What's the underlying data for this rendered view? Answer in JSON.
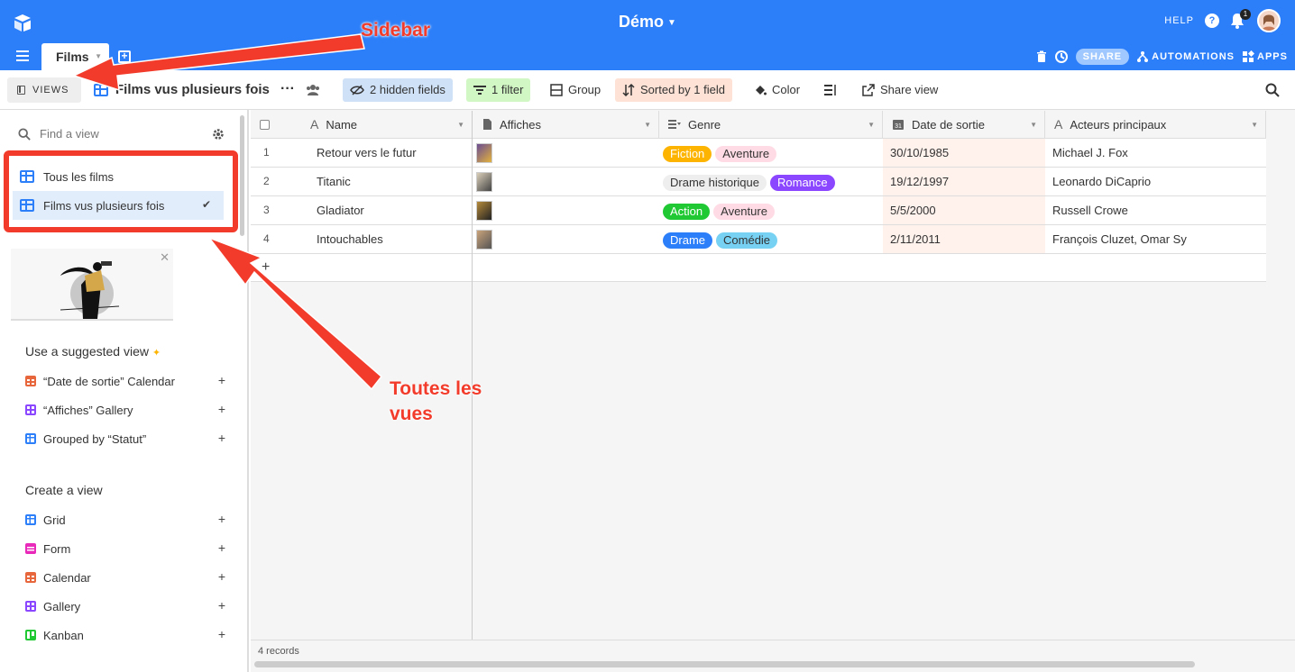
{
  "app": {
    "base_title": "Démo",
    "help_label": "HELP",
    "notification_count": "1"
  },
  "tabs": {
    "active": "Films"
  },
  "header_actions": {
    "share": "SHARE",
    "automations": "AUTOMATIONS",
    "apps": "APPS"
  },
  "toolbar": {
    "views_label": "VIEWS",
    "view_title": "Films vus plusieurs fois",
    "hidden_fields": "2 hidden fields",
    "filter": "1 filter",
    "group": "Group",
    "sort": "Sorted by 1 field",
    "color": "Color",
    "share_view": "Share view"
  },
  "sidebar": {
    "find_placeholder": "Find a view",
    "views": [
      {
        "label": "Tous les films",
        "selected": false
      },
      {
        "label": "Films vus plusieurs fois",
        "selected": true
      }
    ],
    "suggested_title": "Use a suggested view",
    "suggested": [
      {
        "label": "“Date de sortie” Calendar",
        "icon": "calendar-icon",
        "color": "#e8663c"
      },
      {
        "label": "“Affiches” Gallery",
        "icon": "gallery-icon",
        "color": "#8b46ff"
      },
      {
        "label": "Grouped by “Statut”",
        "icon": "grid-icon",
        "color": "#2d7ff9"
      }
    ],
    "create_title": "Create a view",
    "create": [
      {
        "label": "Grid",
        "icon": "grid-icon",
        "color": "#2d7ff9"
      },
      {
        "label": "Form",
        "icon": "form-icon",
        "color": "#e929ba"
      },
      {
        "label": "Calendar",
        "icon": "calendar-icon",
        "color": "#e8663c"
      },
      {
        "label": "Gallery",
        "icon": "gallery-icon",
        "color": "#8b46ff"
      },
      {
        "label": "Kanban",
        "icon": "kanban-icon",
        "color": "#20c933"
      }
    ]
  },
  "grid": {
    "columns": [
      "Name",
      "Affiches",
      "Genre",
      "Date de sortie",
      "Acteurs principaux"
    ],
    "rows": [
      {
        "num": "1",
        "name": "Retour vers le futur",
        "genres": [
          {
            "t": "Fiction",
            "bg": "#fcb400",
            "fg": "#fff"
          },
          {
            "t": "Aventure",
            "bg": "#ffdce5",
            "fg": "#333"
          }
        ],
        "date": "30/10/1985",
        "actors": "Michael J. Fox"
      },
      {
        "num": "2",
        "name": "Titanic",
        "genres": [
          {
            "t": "Drame historique",
            "bg": "#eeeeee",
            "fg": "#333"
          },
          {
            "t": "Romance",
            "bg": "#8b46ff",
            "fg": "#fff"
          }
        ],
        "date": "19/12/1997",
        "actors": "Leonardo DiCaprio"
      },
      {
        "num": "3",
        "name": "Gladiator",
        "genres": [
          {
            "t": "Action",
            "bg": "#20c933",
            "fg": "#fff"
          },
          {
            "t": "Aventure",
            "bg": "#ffdce5",
            "fg": "#333"
          }
        ],
        "date": "5/5/2000",
        "actors": "Russell Crowe"
      },
      {
        "num": "4",
        "name": "Intouchables",
        "genres": [
          {
            "t": "Drame",
            "bg": "#2d7ff9",
            "fg": "#fff"
          },
          {
            "t": "Comédie",
            "bg": "#77d1f3",
            "fg": "#333"
          }
        ],
        "date": "2/11/2011",
        "actors": "François Cluzet, Omar Sy"
      }
    ],
    "record_count": "4 records"
  },
  "annotations": {
    "sidebar_label": "Sidebar",
    "views_label_line1": "Toutes les",
    "views_label_line2": "vues",
    "color": "#f23b2a"
  }
}
